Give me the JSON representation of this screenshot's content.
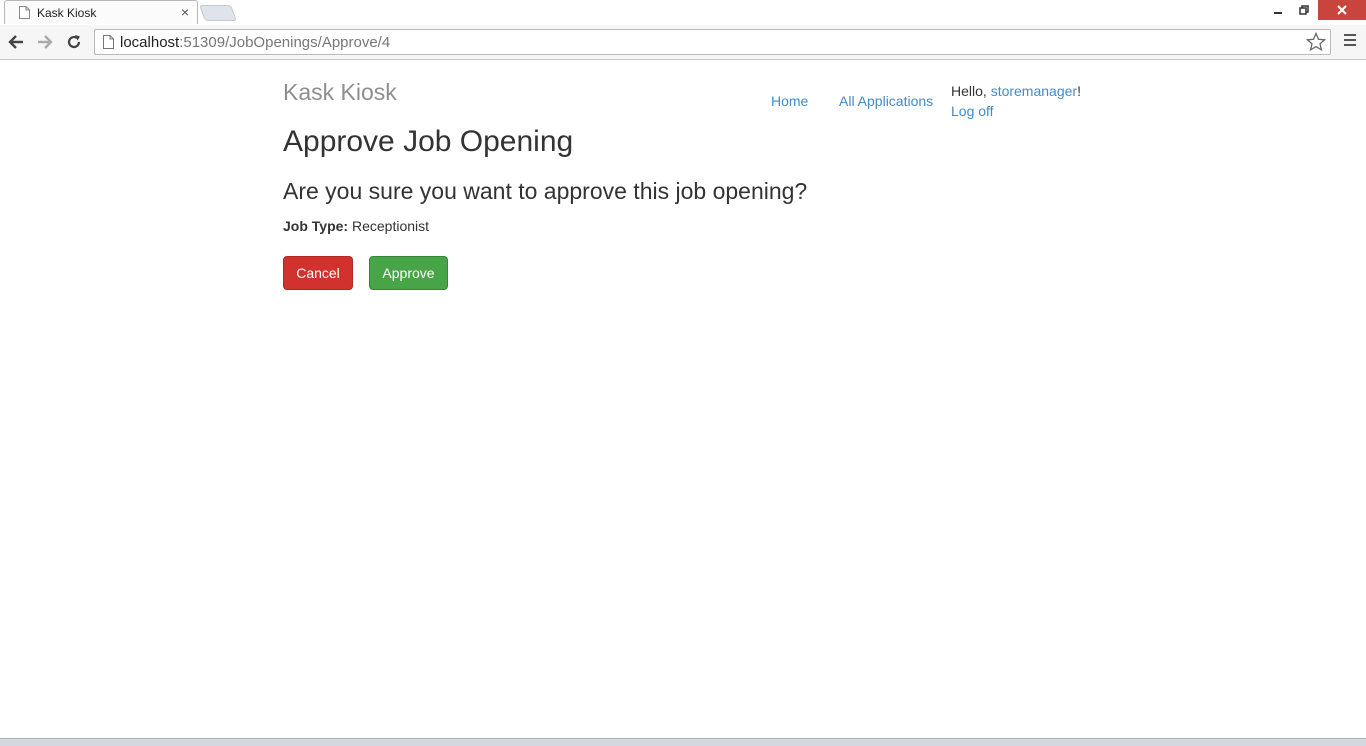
{
  "browser": {
    "tab_title": "Kask Kiosk",
    "tab_close": "×",
    "url_host": "localhost",
    "url_path": ":51309/JobOpenings/Approve/4"
  },
  "site": {
    "brand": "Kask Kiosk",
    "nav": {
      "home": "Home",
      "all_applications": "All Applications"
    },
    "user": {
      "hello": "Hello, ",
      "username": "storemanager",
      "exclaim": "!",
      "logoff": "Log off"
    }
  },
  "main": {
    "title": "Approve Job Opening",
    "question": "Are you sure you want to approve this job opening?",
    "job_type_label": "Job Type:",
    "job_type_value": "Receptionist",
    "cancel_label": "Cancel",
    "approve_label": "Approve"
  },
  "colors": {
    "link": "#428bca",
    "cancel": "#d2322d",
    "approve": "#47a447",
    "brand": "#8f8f8f"
  }
}
